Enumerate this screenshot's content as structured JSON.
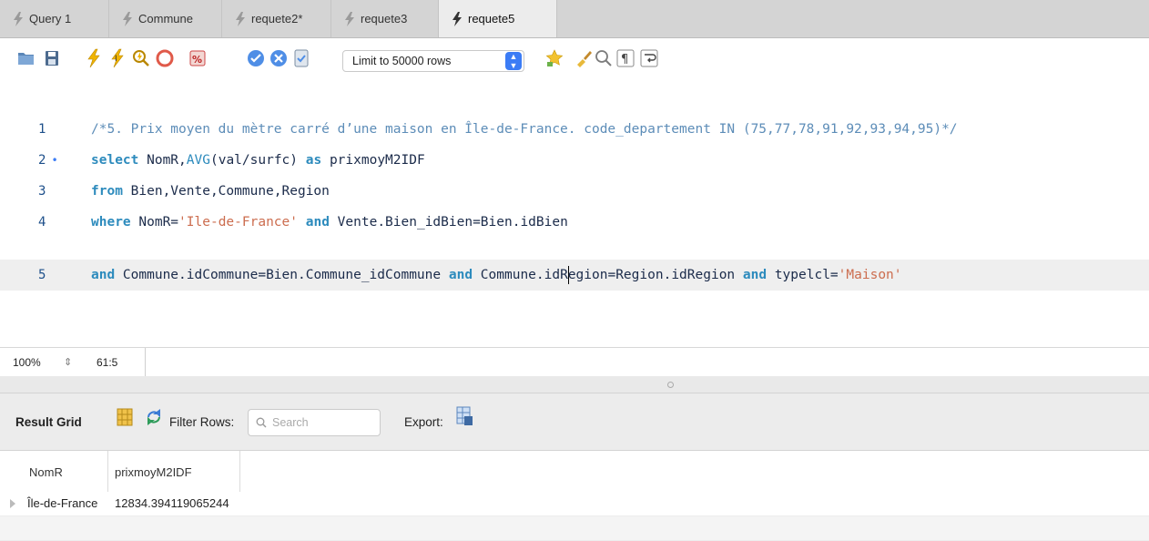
{
  "tabs": [
    {
      "label": "Query 1",
      "active": false
    },
    {
      "label": "Commune",
      "active": false
    },
    {
      "label": "requete2*",
      "active": false
    },
    {
      "label": "requete3",
      "active": false
    },
    {
      "label": "requete5",
      "active": true
    }
  ],
  "toolbar": {
    "limit_value": "Limit to 50000 rows",
    "icons": [
      "open-file-icon",
      "save-icon",
      "execute-icon",
      "execute-current-icon",
      "explain-icon",
      "stop-icon",
      "toggle-error-icon",
      "commit-icon",
      "rollback-icon",
      "autocommit-icon",
      "beautify-icon",
      "brush-icon",
      "find-icon",
      "invisible-chars-icon",
      "wrap-icon"
    ]
  },
  "editor": {
    "lines": [
      {
        "num": "1",
        "text": "/*5. Prix moyen du mètre carré d’une maison en Île-de-France. code_departement IN (75,77,78,91,92,93,94,95)*/"
      },
      {
        "num": "2",
        "marker": "•",
        "kw1": "select",
        "t1": " NomR,",
        "fn1": "AVG",
        "t2": "(val/surfc) ",
        "kw2": "as",
        "t3": " prixmoyM2IDF"
      },
      {
        "num": "3",
        "kw1": "from",
        "t1": " Bien,Vente,Commune,Region"
      },
      {
        "num": "4",
        "kw1": "where",
        "t1": " NomR=",
        "s1": "'Ile-de-France'",
        "t2": " ",
        "kw2": "and",
        "t3": " Vente.Bien_idBien=Bien.idBien"
      },
      {
        "num": "5",
        "kw1": "and",
        "t1": " Commune.idCommune=Bien.Commune_idCommune ",
        "kw2": "and",
        "t2a": " Commune.idR",
        "t2b": "egion=Region.idRegion ",
        "kw3": "and",
        "t3": " typelcl=",
        "s1": "'Maison'"
      }
    ]
  },
  "status": {
    "zoom": "100%",
    "position": "61:5"
  },
  "results": {
    "title": "Result Grid",
    "filter_label": "Filter Rows:",
    "search_placeholder": "Search",
    "export_label": "Export:",
    "columns": [
      "NomR",
      "prixmoyM2IDF"
    ],
    "rows": [
      [
        "Île-de-France",
        "12834.394119065244"
      ]
    ]
  },
  "colors": {
    "keyword": "#2d8bbd",
    "string": "#cc6d4f",
    "comment": "#5d8db8",
    "accent": "#3b7cf5"
  }
}
